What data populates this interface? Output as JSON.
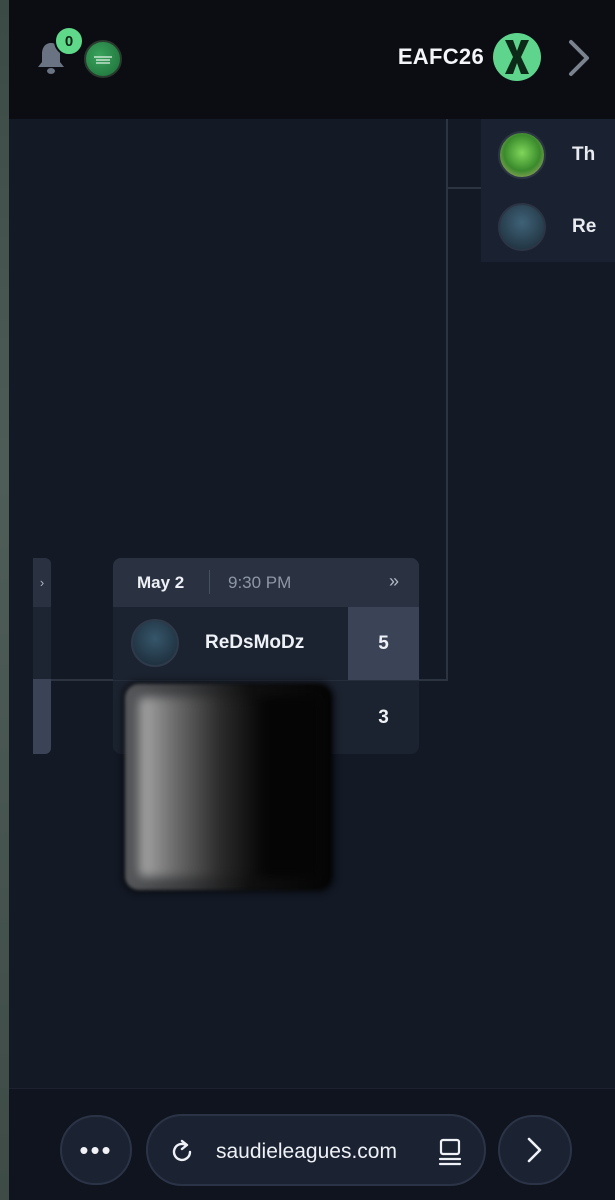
{
  "header": {
    "notification_count": "0",
    "game_title": "EAFC26",
    "icons": {
      "bell": "bell-icon",
      "region_flag": "saudi-flag-icon",
      "game_logo": "game-logo-icon",
      "next": "chevron-right-icon"
    }
  },
  "side_match": {
    "players": [
      {
        "name": "Th"
      },
      {
        "name": "Re"
      }
    ]
  },
  "match": {
    "date": "May 2",
    "time": "9:30 PM",
    "more_icon": "double-chevron-right-icon",
    "players": [
      {
        "name": "ReDsMoDz",
        "score": "5",
        "winner": true
      },
      {
        "name": "",
        "score": "3",
        "winner": false
      }
    ]
  },
  "browser": {
    "menu_label": "•••",
    "url": "saudieleagues.com",
    "icons": {
      "reload": "reload-icon",
      "tabs": "tabs-icon",
      "forward": "chevron-right-icon"
    }
  },
  "colors": {
    "background": "#131925",
    "header": "#0b0d12",
    "accent_green": "#5fd88a",
    "card": "#1c2330",
    "card_header": "#2a3242",
    "winner_cell": "#3a4456"
  }
}
